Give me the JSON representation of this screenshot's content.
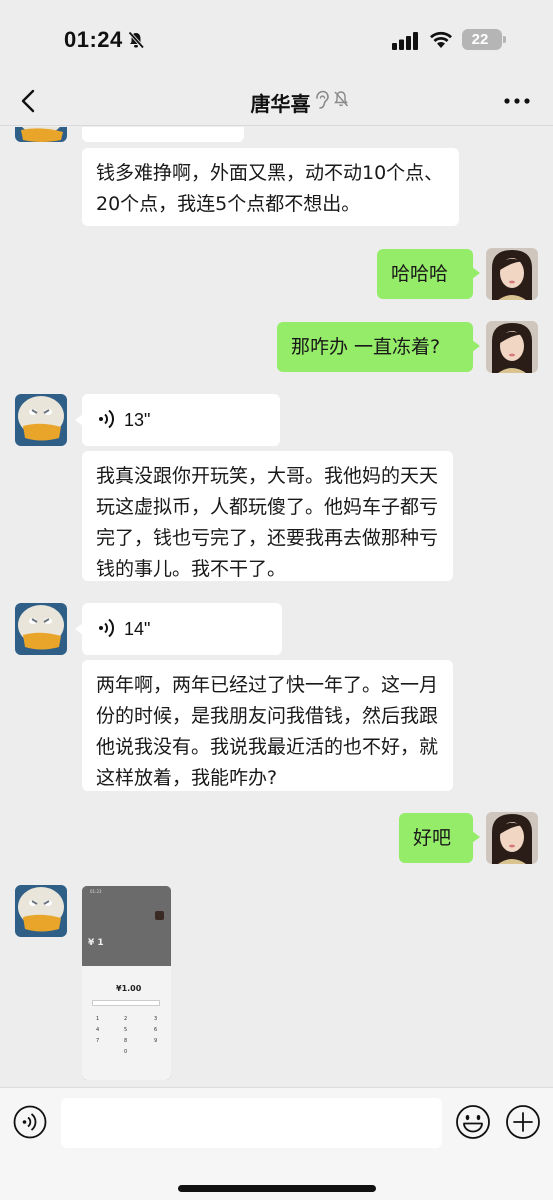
{
  "status_bar": {
    "time": "01:24",
    "battery": "22"
  },
  "header": {
    "title": "唐华喜"
  },
  "messages": [
    {
      "id": "m1",
      "side": "in",
      "type": "text",
      "text": "钱多难挣啊，外面又黑，动不动10个点、20个点，我连5个点都不想出。"
    },
    {
      "id": "m2",
      "side": "out",
      "type": "text",
      "text": "哈哈哈"
    },
    {
      "id": "m3",
      "side": "out",
      "type": "text",
      "text": "那咋办 一直冻着?"
    },
    {
      "id": "m4",
      "side": "in",
      "type": "voice",
      "duration": "13\""
    },
    {
      "id": "m5",
      "side": "in",
      "type": "text",
      "text": "我真没跟你开玩笑，大哥。我他妈的天天玩这虚拟币，人都玩傻了。他妈车子都亏完了，钱也亏完了，还要我再去做那种亏钱的事儿。我不干了。"
    },
    {
      "id": "m6",
      "side": "in",
      "type": "voice",
      "duration": "14\""
    },
    {
      "id": "m7",
      "side": "in",
      "type": "text",
      "text": "两年啊，两年已经过了快一年了。这一月份的时候，是我朋友问我借钱，然后我跟他说我没有。我说我最近活的也不好，就这样放着，我能咋办?"
    },
    {
      "id": "m8",
      "side": "out",
      "type": "text",
      "text": "好吧"
    },
    {
      "id": "m9",
      "side": "in",
      "type": "image",
      "image": {
        "time": "01:23",
        "amount_top": "¥ 1",
        "amount_sheet": "¥1.00",
        "keypad": [
          "1",
          "2",
          "3",
          "4",
          "5",
          "6",
          "7",
          "8",
          "9",
          "0"
        ]
      }
    }
  ],
  "input": {
    "placeholder": ""
  }
}
